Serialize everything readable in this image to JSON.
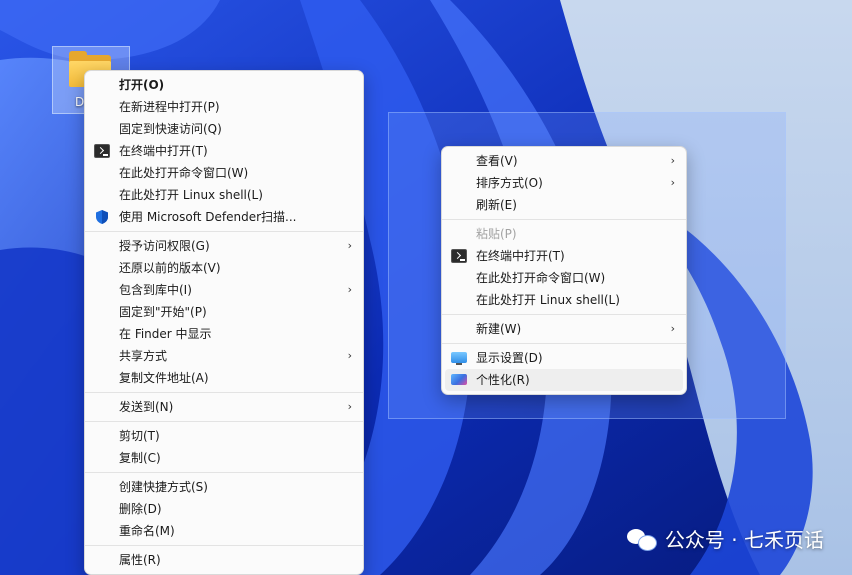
{
  "desktop": {
    "folder_label": "D"
  },
  "left_menu": {
    "groups": [
      [
        {
          "label": "打开(O)",
          "bold": true
        },
        {
          "label": "在新进程中打开(P)"
        },
        {
          "label": "固定到快速访问(Q)"
        },
        {
          "label": "在终端中打开(T)",
          "icon": "terminal-icon"
        },
        {
          "label": "在此处打开命令窗口(W)"
        },
        {
          "label": "在此处打开 Linux shell(L)"
        },
        {
          "label": "使用 Microsoft Defender扫描...",
          "icon": "shield-icon"
        }
      ],
      [
        {
          "label": "授予访问权限(G)",
          "submenu": true
        },
        {
          "label": "还原以前的版本(V)"
        },
        {
          "label": "包含到库中(I)",
          "submenu": true
        },
        {
          "label": "固定到\"开始\"(P)"
        },
        {
          "label": "在 Finder 中显示"
        },
        {
          "label": "共享方式",
          "submenu": true
        },
        {
          "label": "复制文件地址(A)"
        }
      ],
      [
        {
          "label": "发送到(N)",
          "submenu": true
        }
      ],
      [
        {
          "label": "剪切(T)"
        },
        {
          "label": "复制(C)"
        }
      ],
      [
        {
          "label": "创建快捷方式(S)"
        },
        {
          "label": "删除(D)"
        },
        {
          "label": "重命名(M)"
        }
      ],
      [
        {
          "label": "属性(R)"
        }
      ]
    ]
  },
  "right_menu": {
    "groups": [
      [
        {
          "label": "查看(V)",
          "submenu": true
        },
        {
          "label": "排序方式(O)",
          "submenu": true
        },
        {
          "label": "刷新(E)"
        }
      ],
      [
        {
          "label": "粘贴(P)",
          "disabled": true
        },
        {
          "label": "在终端中打开(T)",
          "icon": "terminal-icon"
        },
        {
          "label": "在此处打开命令窗口(W)"
        },
        {
          "label": "在此处打开 Linux shell(L)"
        }
      ],
      [
        {
          "label": "新建(W)",
          "submenu": true
        }
      ],
      [
        {
          "label": "显示设置(D)",
          "icon": "monitor-icon"
        },
        {
          "label": "个性化(R)",
          "icon": "personalize-icon",
          "hover": true
        }
      ]
    ]
  },
  "watermark": {
    "text": "公众号 · 七禾页话"
  },
  "icons": {
    "submenu_arrow": "›"
  }
}
